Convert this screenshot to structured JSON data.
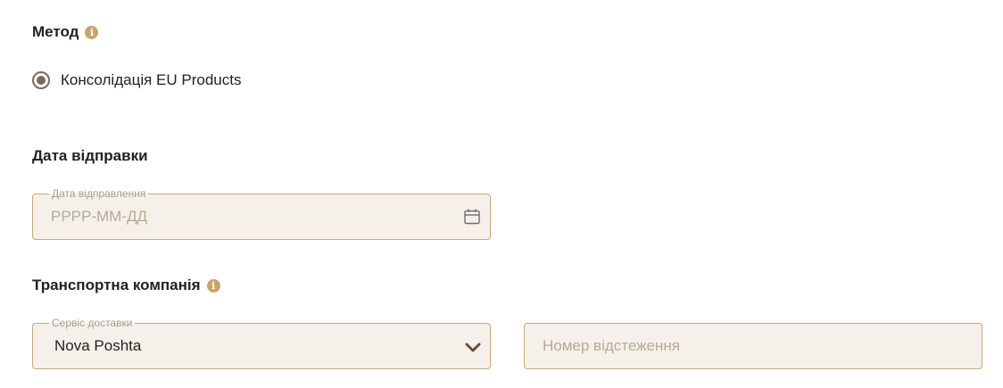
{
  "method": {
    "title": "Метод",
    "option_label": "Консолідація EU Products",
    "selected": true
  },
  "shipping_date": {
    "title": "Дата відправки",
    "field_label": "Дата відправлення",
    "placeholder": "РРРР-ММ-ДД"
  },
  "carrier": {
    "title": "Транспортна компанія",
    "service_label": "Сервіс доставки",
    "service_value": "Nova Poshta",
    "tracking_placeholder": "Номер відстеження"
  },
  "icons": {
    "info": "info-icon",
    "calendar": "calendar-icon",
    "dropdown": "chevron-down-icon"
  },
  "colors": {
    "accent": "#c9a46a",
    "field_border": "#c9a77b",
    "field_bg": "#f5f1ea",
    "radio": "#7a6a5c"
  }
}
